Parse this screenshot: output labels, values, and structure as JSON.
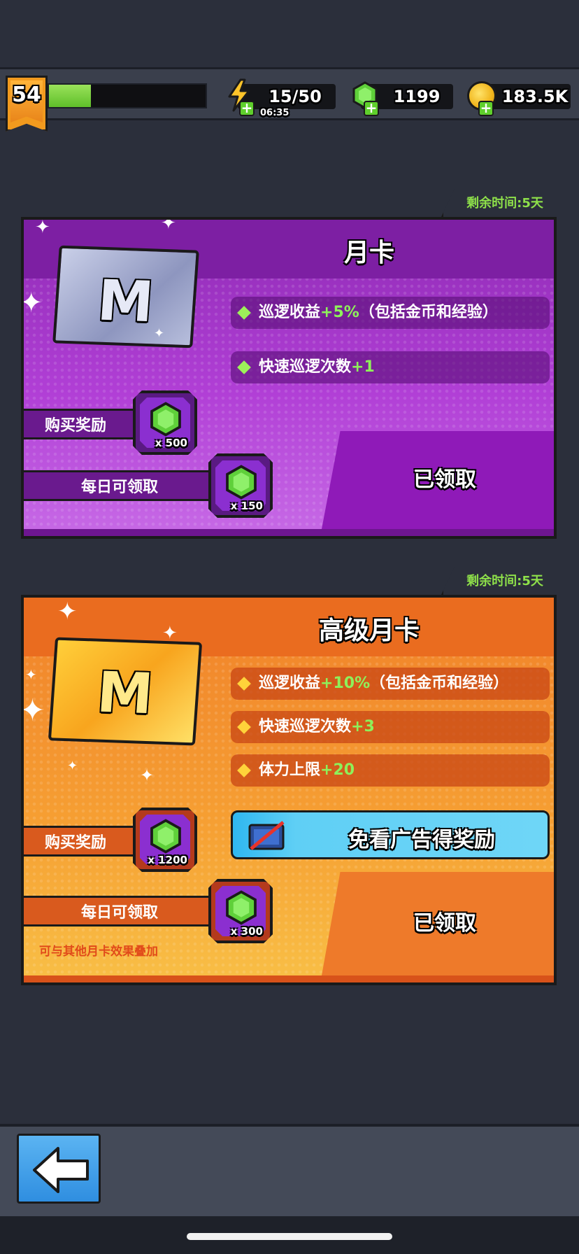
{
  "header": {
    "level": "54",
    "xp_progress": 0.27,
    "energy": "15/50",
    "energy_timer": "06:35",
    "gems": "1199",
    "coins": "183.5K"
  },
  "monthly_card": {
    "title": "月卡",
    "timer": "剩余时间:5天",
    "perks": [
      {
        "prefix": "巡逻收益",
        "accent": "+5%",
        "suffix": "（包括金币和经验）"
      },
      {
        "prefix": "快速巡逻次数",
        "accent": "+1",
        "suffix": ""
      }
    ],
    "purchase_label": "购买奖励",
    "purchase_gems": "x 500",
    "daily_label": "每日可领取",
    "daily_gems": "x 150",
    "claimed_label": "已领取",
    "card_icon": "M"
  },
  "premium_card": {
    "title": "高级月卡",
    "timer": "剩余时间:5天",
    "perks": [
      {
        "prefix": "巡逻收益",
        "accent": "+10%",
        "suffix": "（包括金币和经验）"
      },
      {
        "prefix": "快速巡逻次数",
        "accent": "+3",
        "suffix": ""
      },
      {
        "prefix": "体力上限",
        "accent": "+20",
        "suffix": ""
      }
    ],
    "ad_free_label": "免看广告得奖励",
    "purchase_label": "购买奖励",
    "purchase_gems": "x 1200",
    "daily_label": "每日可领取",
    "daily_gems": "x 300",
    "claimed_label": "已领取",
    "stack_note": "可与其他月卡效果叠加",
    "card_icon": "M"
  },
  "icons": {
    "back": "left-arrow-icon",
    "energy": "lightning-icon",
    "gem": "green-gem-icon",
    "coin": "gold-coin-icon",
    "ad": "no-ads-tv-icon"
  },
  "colors": {
    "accent_green": "#8ef05a",
    "monthly_purple": "#8f2bb5",
    "premium_orange": "#f0812a",
    "timer_green": "#8ee04a"
  }
}
